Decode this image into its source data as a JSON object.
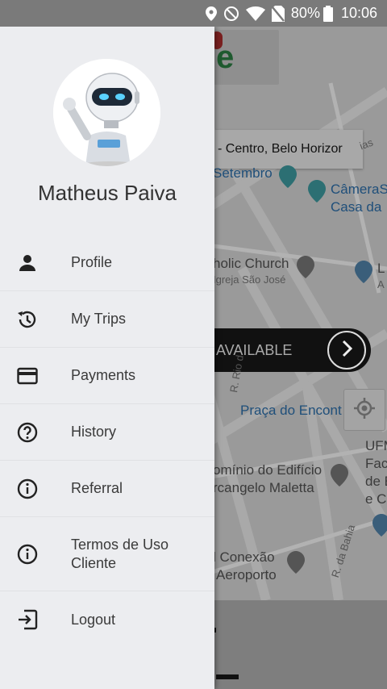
{
  "status_bar": {
    "battery": "80%",
    "time": "10:06",
    "icons": [
      "location-icon",
      "do-not-disturb-icon",
      "wifi-icon",
      "no-sim-icon",
      "battery-icon"
    ]
  },
  "map": {
    "address_text": "- Centro, Belo Horizor",
    "availability_text": "AVAILABLE",
    "labels": {
      "setembro": "Setembro",
      "camera_1": "CâmeraS",
      "camera_2": "Casa da",
      "church_1": "holic Church",
      "church_2": "Igreja São José",
      "l_1": "L",
      "l_2": "A",
      "praca": "Praça do Encont",
      "ufm_1": "UFM",
      "ufm_2": "Fac",
      "ufm_3": "de E",
      "ufm_4": "e C",
      "edificio_1": "omínio do Edifício",
      "edificio_2": "rcangelo Maletta",
      "conexao_1": "l Conexão",
      "conexao_2": "Aeroporto",
      "rua_rio": "R. Rio d",
      "rua_bahia": "R. da Bahia",
      "rua_ias": "ias"
    }
  },
  "drawer": {
    "user_name": "Matheus Paiva",
    "menu": [
      {
        "label": "Profile",
        "icon": "person-icon"
      },
      {
        "label": "My Trips",
        "icon": "history-clock-icon"
      },
      {
        "label": "Payments",
        "icon": "credit-card-icon"
      },
      {
        "label": "History",
        "icon": "help-circle-icon"
      },
      {
        "label": "Referral",
        "icon": "info-icon"
      },
      {
        "label": "Termos de Uso\nCliente",
        "icon": "info-icon"
      },
      {
        "label": "Logout",
        "icon": "logout-icon"
      }
    ]
  }
}
